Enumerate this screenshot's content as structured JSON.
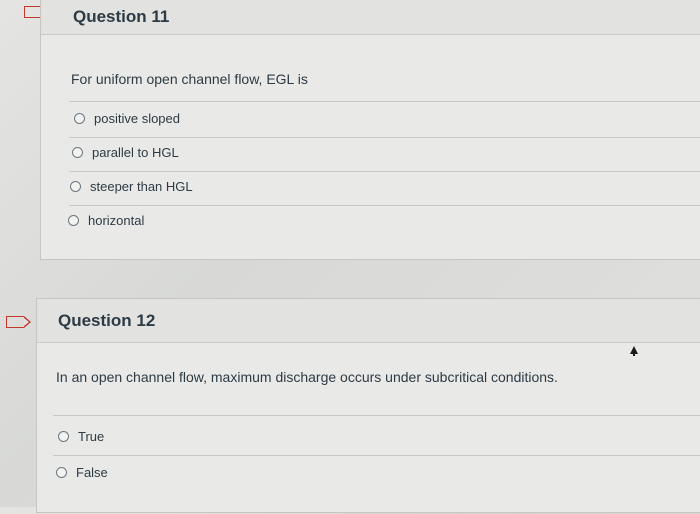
{
  "q11": {
    "title": "Question 11",
    "prompt": "For uniform open channel flow, EGL is",
    "options": [
      "positive sloped",
      "parallel to HGL",
      "steeper than HGL",
      "horizontal"
    ]
  },
  "q12": {
    "title": "Question 12",
    "prompt": "In an open channel flow, maximum discharge occurs under subcritical conditions.",
    "options": [
      "True",
      "False"
    ]
  },
  "colors": {
    "flag": "#c0392b",
    "text": "#2d3b45"
  }
}
